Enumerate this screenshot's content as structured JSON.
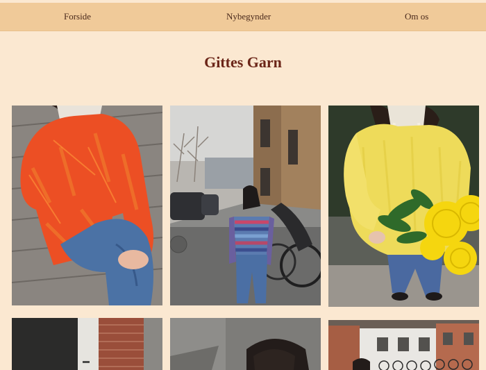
{
  "nav": {
    "items": [
      {
        "label": "Forside"
      },
      {
        "label": "Nybegynder"
      },
      {
        "label": "Om os"
      }
    ]
  },
  "page": {
    "title": "Gittes Garn"
  },
  "gallery": {
    "photos": [
      {
        "name": "orange-sweater-photo"
      },
      {
        "name": "striped-sweater-street-photo"
      },
      {
        "name": "yellow-sweater-flowers-photo"
      },
      {
        "name": "storefront-photo"
      },
      {
        "name": "street-portrait-photo"
      },
      {
        "name": "building-bikes-photo"
      }
    ]
  },
  "colors": {
    "background": "#fbe8d1",
    "nav_background": "#f0ca99",
    "title": "#6b2518",
    "nav_text": "#4a2a1c"
  }
}
